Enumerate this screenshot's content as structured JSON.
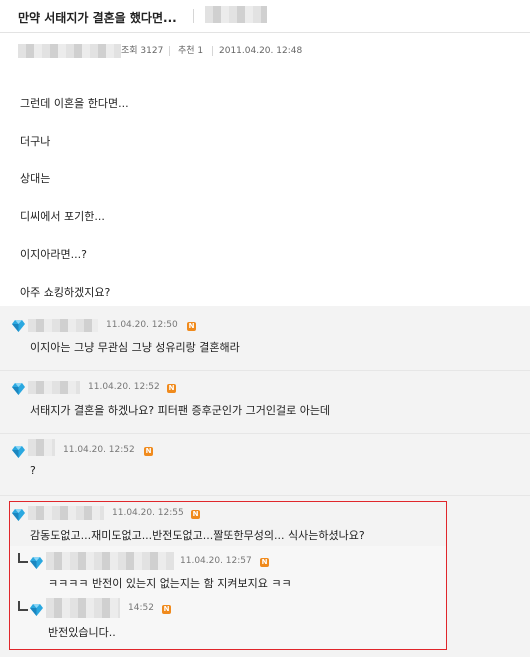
{
  "post": {
    "title": "만약 서태지가 결혼을 했다면...",
    "meta": {
      "views": "조회 3127",
      "recommend": "추천 1",
      "date": "2011.04.20. 12:48"
    },
    "lines": [
      "그런데 이혼을 한다면...",
      "더구나",
      "상대는",
      "디씨에서 포기한...",
      "이지아라면...?",
      "아주 쇼킹하겠지요?"
    ]
  },
  "comments": [
    {
      "time": "11.04.20. 12:50",
      "text": "이지아는 그냥 무관심 그냥 성유리랑 결혼해라",
      "badge": "N"
    },
    {
      "time": "11.04.20. 12:52",
      "text": "서태지가 결혼을 하겠나요? 피터팬 증후군인가 그거인걸로 아는데",
      "badge": "N"
    },
    {
      "time": "11.04.20. 12:52",
      "text": "?",
      "badge": "N"
    },
    {
      "time": "11.04.20. 12:55",
      "text": "감동도없고...재미도없고...반전도없고...짤또한무성의... 식사는하셨나요?",
      "badge": "N"
    }
  ],
  "replies": [
    {
      "time": "11.04.20. 12:57",
      "text": "ㅋㅋㅋㅋ 반전이 있는지 없는지는 함 지켜보지요 ㅋㅋ",
      "badge": "N"
    },
    {
      "time": "14:52",
      "text": "반전있습니다..",
      "badge": "N"
    }
  ],
  "colors": {
    "gem": "#2aa8e0",
    "badge": "#f08a1c",
    "highlight": "#e0262b",
    "comment_bg": "#f3f3f3"
  },
  "icons": {
    "gem": "diamond-icon",
    "reply": "reply-arrow-icon",
    "new": "new-badge-icon"
  }
}
